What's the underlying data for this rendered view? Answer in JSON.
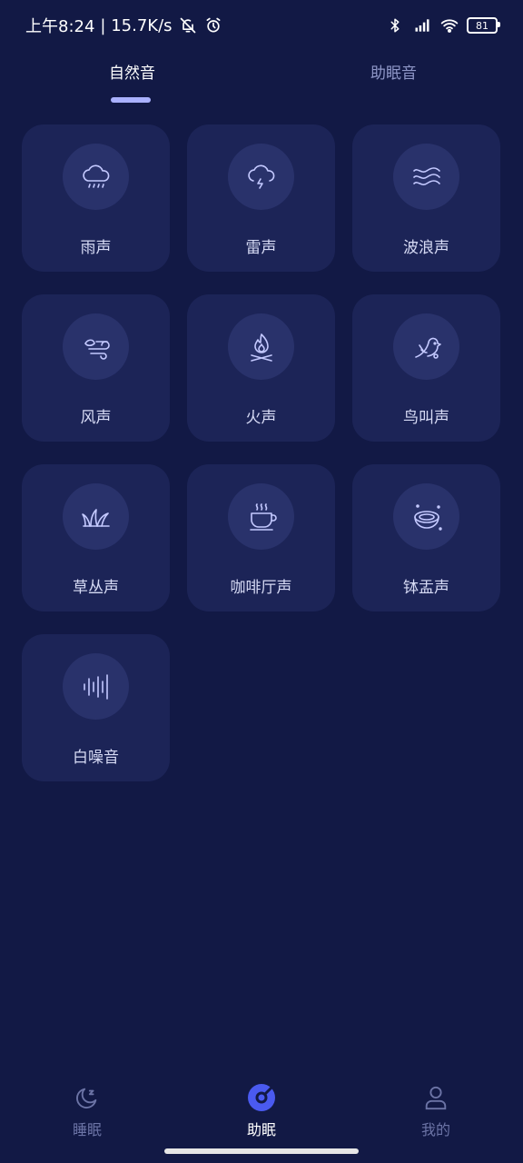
{
  "status_bar": {
    "time": "上午8:24",
    "network_speed": "| 15.7K/s",
    "battery_level": "81"
  },
  "top_tabs": [
    {
      "label": "自然音",
      "active": true
    },
    {
      "label": "助眠音",
      "active": false
    }
  ],
  "sounds": [
    {
      "label": "雨声",
      "icon": "rain-cloud-icon"
    },
    {
      "label": "雷声",
      "icon": "thunder-cloud-icon"
    },
    {
      "label": "波浪声",
      "icon": "waves-icon"
    },
    {
      "label": "风声",
      "icon": "wind-icon"
    },
    {
      "label": "火声",
      "icon": "campfire-icon"
    },
    {
      "label": "鸟叫声",
      "icon": "bird-icon"
    },
    {
      "label": "草丛声",
      "icon": "grass-icon"
    },
    {
      "label": "咖啡厅声",
      "icon": "coffee-cup-icon"
    },
    {
      "label": "钵盂声",
      "icon": "singing-bowl-icon"
    },
    {
      "label": "白噪音",
      "icon": "sound-bars-icon"
    }
  ],
  "bottom_nav": [
    {
      "label": "睡眠",
      "icon": "moon-icon",
      "active": false
    },
    {
      "label": "助眠",
      "icon": "disc-icon",
      "active": true
    },
    {
      "label": "我的",
      "icon": "person-icon",
      "active": false
    }
  ],
  "colors": {
    "background": "#121945",
    "card": "#1c2457",
    "icon_circle": "#29326b",
    "accent": "#aab1ff",
    "icon_stroke": "#c4c9ff"
  }
}
